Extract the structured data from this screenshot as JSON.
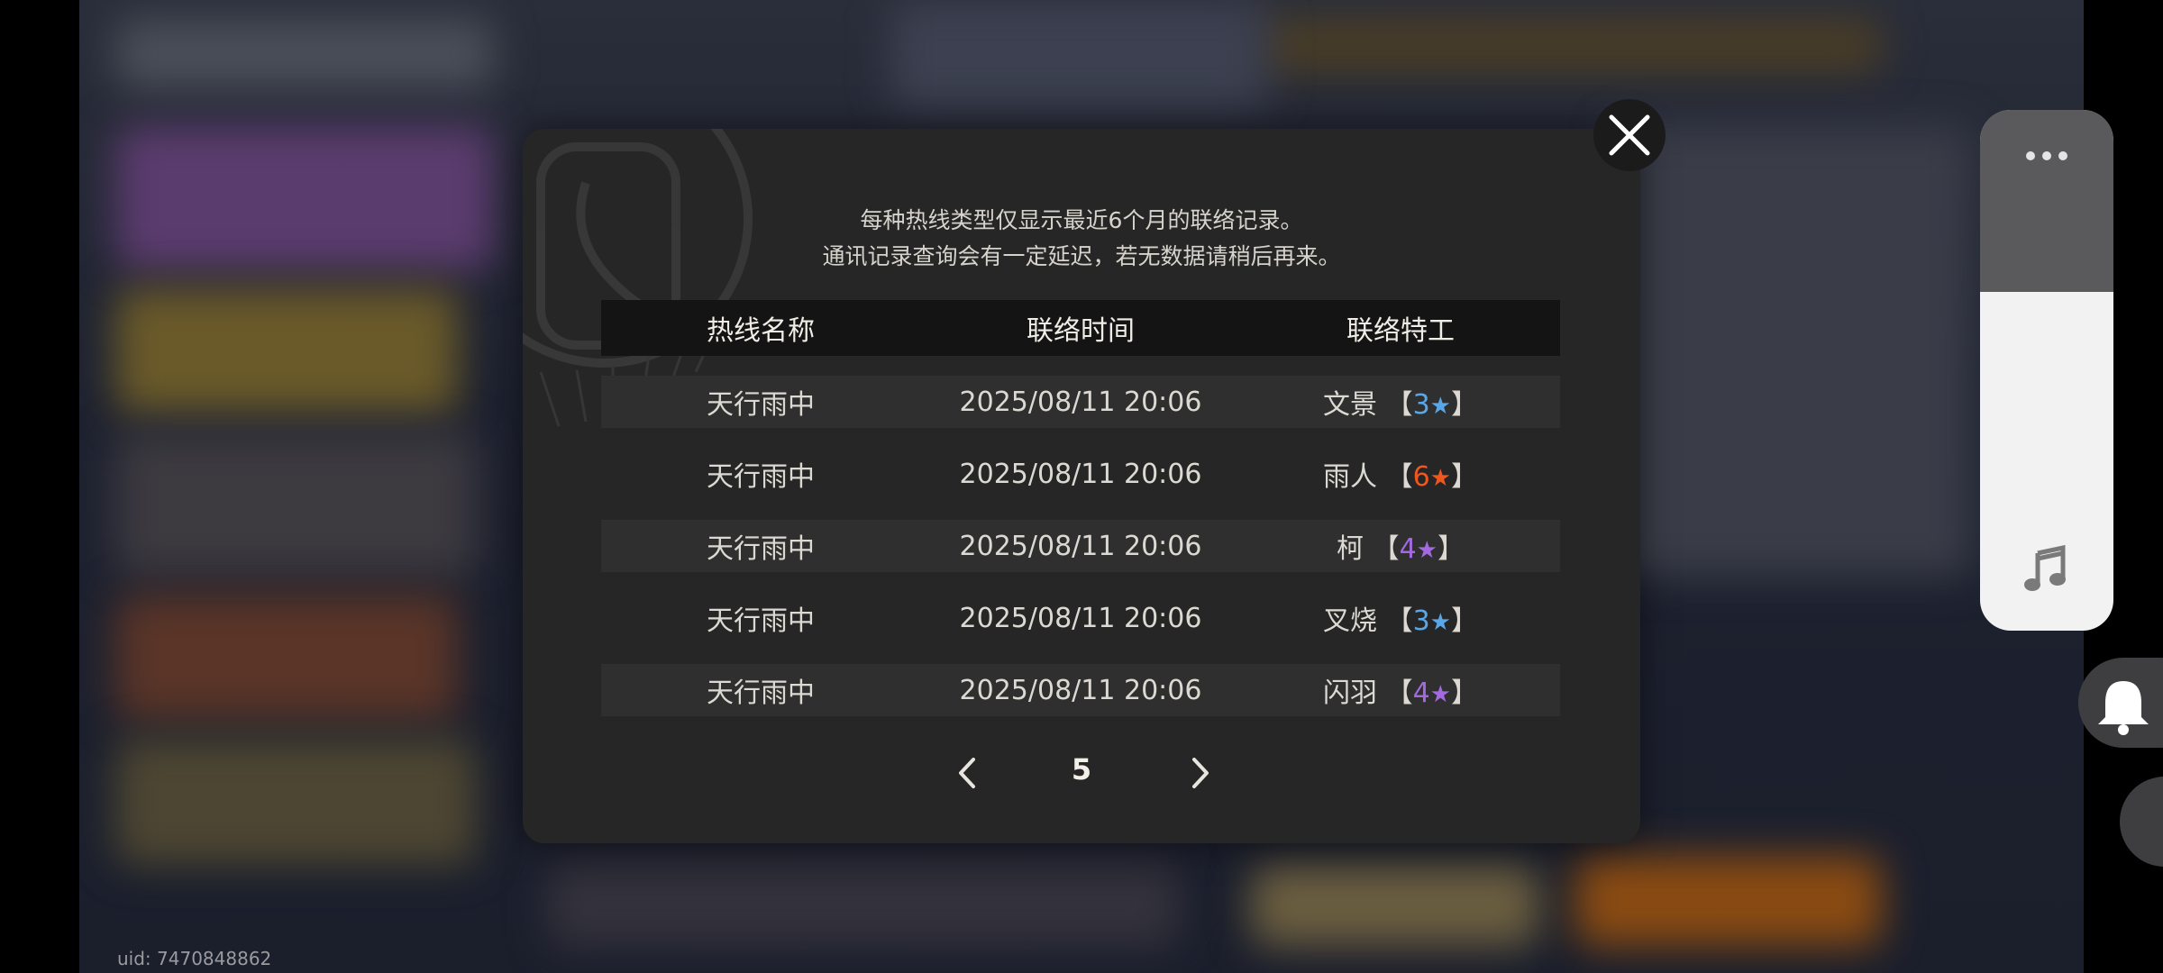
{
  "uid_label": "uid: 7470848862",
  "dialog": {
    "notice_line1": "每种热线类型仅显示最近6个月的联络记录。",
    "notice_line2": "通讯记录查询会有一定延迟，若无数据请稍后再来。",
    "columns": [
      "热线名称",
      "联络时间",
      "联络特工"
    ],
    "rows": [
      {
        "hotline": "天行雨中",
        "time": "2025/08/11 20:06",
        "agent": "文景",
        "rank": "3",
        "rank_color": "#5aa7e8",
        "striped": true
      },
      {
        "hotline": "天行雨中",
        "time": "2025/08/11 20:06",
        "agent": "雨人",
        "rank": "6",
        "rank_color": "#f0571e",
        "striped": false
      },
      {
        "hotline": "天行雨中",
        "time": "2025/08/11 20:06",
        "agent": "柯",
        "rank": "4",
        "rank_color": "#a36ae0",
        "striped": true
      },
      {
        "hotline": "天行雨中",
        "time": "2025/08/11 20:06",
        "agent": "叉烧",
        "rank": "3",
        "rank_color": "#5aa7e8",
        "striped": false
      },
      {
        "hotline": "天行雨中",
        "time": "2025/08/11 20:06",
        "agent": "闪羽",
        "rank": "4",
        "rank_color": "#a36ae0",
        "striped": true
      }
    ],
    "page": "5",
    "bracket_open": "【",
    "bracket_close": "】",
    "star_glyph": "★"
  },
  "icons": {
    "close": "close-icon",
    "prev": "chevron-left-icon",
    "next": "chevron-right-icon",
    "more": "more-dots-icon",
    "music": "music-note-icon",
    "bell": "bell-icon",
    "phone_watermark": "phone-icon"
  }
}
